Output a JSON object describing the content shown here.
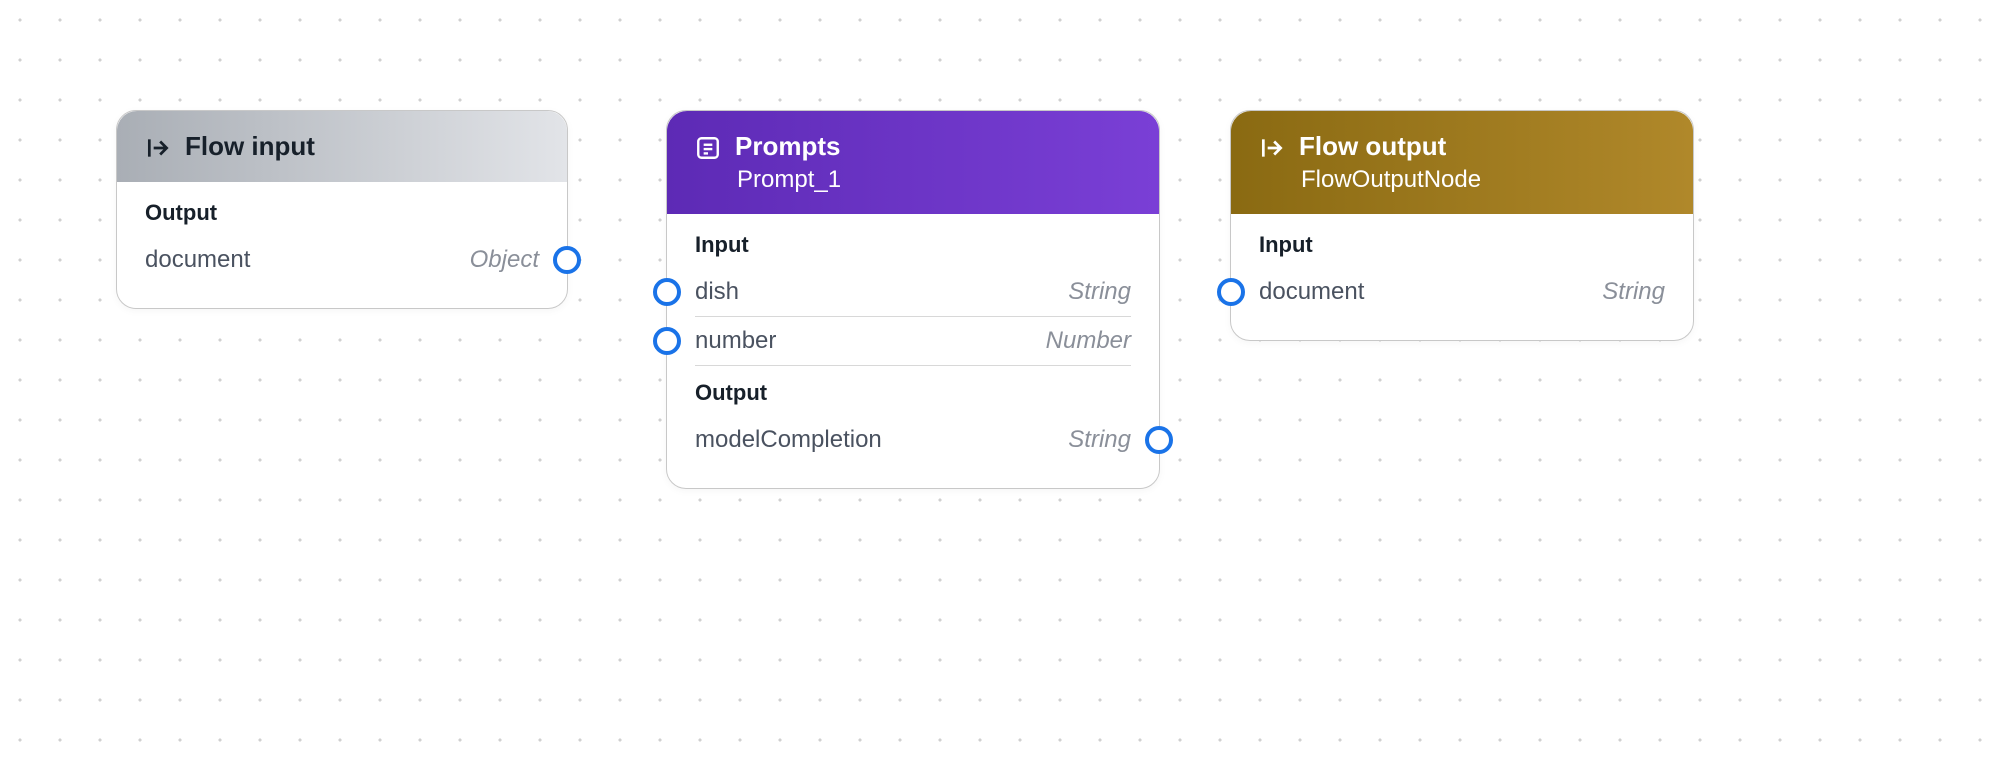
{
  "nodes": {
    "flowInput": {
      "title": "Flow input",
      "outputLabel": "Output",
      "outputs": [
        {
          "name": "document",
          "type": "Object"
        }
      ]
    },
    "prompts": {
      "title": "Prompts",
      "subtitle": "Prompt_1",
      "inputLabel": "Input",
      "inputs": [
        {
          "name": "dish",
          "type": "String"
        },
        {
          "name": "number",
          "type": "Number"
        }
      ],
      "outputLabel": "Output",
      "outputs": [
        {
          "name": "modelCompletion",
          "type": "String"
        }
      ]
    },
    "flowOutput": {
      "title": "Flow output",
      "subtitle": "FlowOutputNode",
      "inputLabel": "Input",
      "inputs": [
        {
          "name": "document",
          "type": "String"
        }
      ]
    }
  }
}
